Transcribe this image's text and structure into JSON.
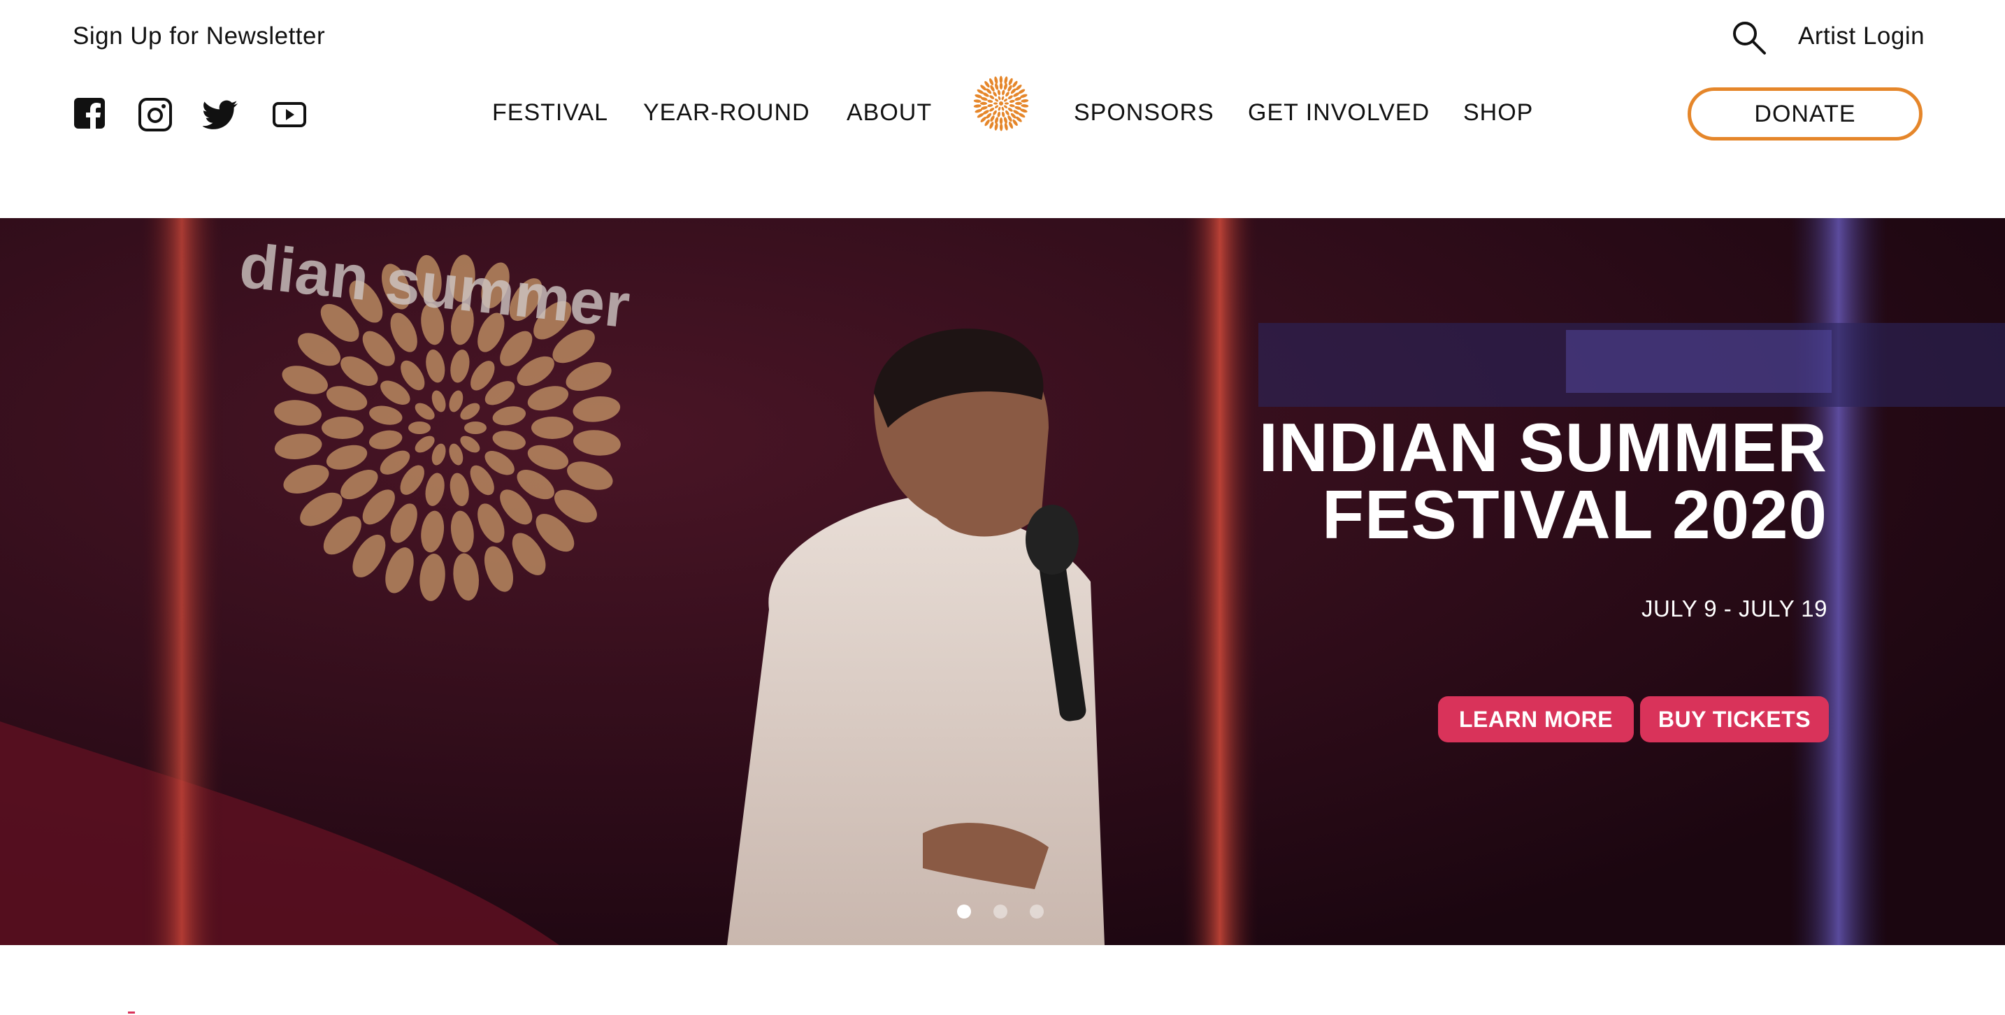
{
  "header": {
    "newsletter_label": "Sign Up for Newsletter",
    "artist_login_label": "Artist Login",
    "donate_label": "DONATE",
    "social_icons": [
      "facebook-icon",
      "instagram-icon",
      "twitter-icon",
      "youtube-icon"
    ],
    "logo_icon": "sunburst-logo-icon"
  },
  "nav": {
    "items": [
      {
        "label": "FESTIVAL"
      },
      {
        "label": "YEAR-ROUND"
      },
      {
        "label": "ABOUT"
      },
      {
        "label": "SPONSORS"
      },
      {
        "label": "GET INVOLVED"
      },
      {
        "label": "SHOP"
      }
    ]
  },
  "hero": {
    "title_line1": "INDIAN SUMMER",
    "title_line2": "FESTIVAL 2020",
    "dates": "JULY 9 - JULY 19",
    "learn_more_label": "LEARN MORE",
    "buy_tickets_label": "BUY TICKETS",
    "backdrop_text": "dian summer",
    "slides": 3,
    "active_slide": 1
  },
  "colors": {
    "accent_orange": "#e5862a",
    "button_red": "#d9335a",
    "hero_bg": "#2a0a18"
  }
}
